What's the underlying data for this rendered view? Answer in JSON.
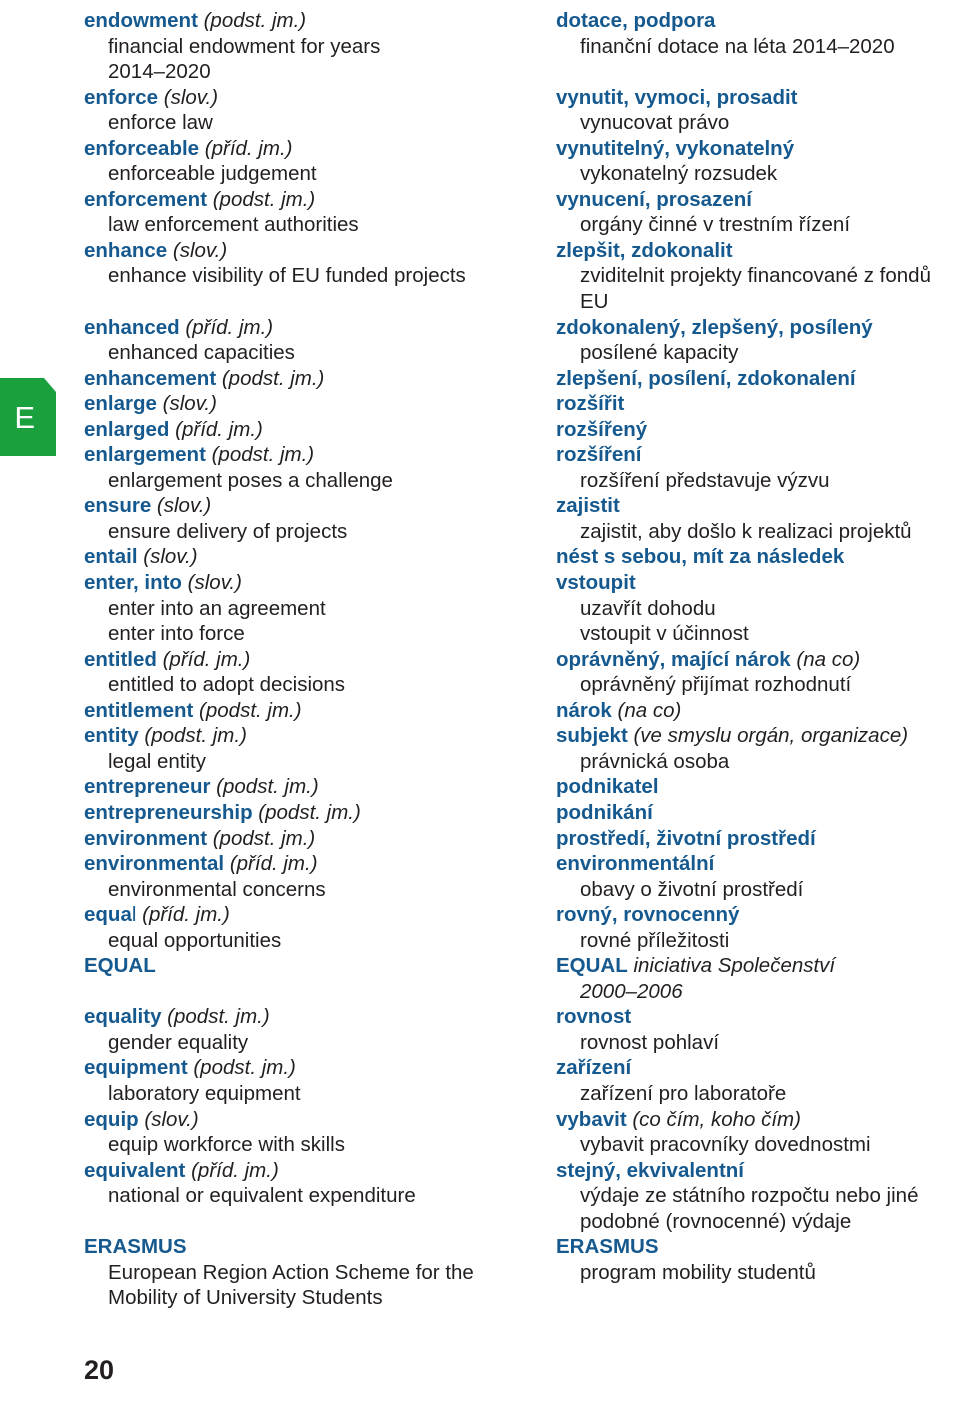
{
  "page": {
    "folio": "20",
    "letter_tab": "E",
    "colors": {
      "headword_blue": "#15598F",
      "tab_green": "#1AA03D",
      "body_text": "#231f20",
      "background": "#ffffff"
    }
  },
  "columns": {
    "english": [
      {
        "type": "head",
        "hw": "endowment",
        "pos": "(podst. jm.)"
      },
      {
        "type": "sub",
        "text": "financial endowment for years"
      },
      {
        "type": "cont",
        "text": "2014–2020"
      },
      {
        "type": "head",
        "hw": "enforce",
        "pos": "(slov.)"
      },
      {
        "type": "sub",
        "text": "enforce law"
      },
      {
        "type": "head",
        "hw": "enforceable",
        "pos": "(příd. jm.)"
      },
      {
        "type": "sub",
        "text": "enforceable judgement"
      },
      {
        "type": "head",
        "hw": "enforcement",
        "pos": "(podst. jm.)"
      },
      {
        "type": "sub",
        "text": "law enforcement authorities"
      },
      {
        "type": "head",
        "hw": "enhance",
        "pos": "(slov.)"
      },
      {
        "type": "sub",
        "text": "enhance visibility of EU funded projects"
      },
      {
        "type": "blank"
      },
      {
        "type": "head",
        "hw": "enhanced",
        "pos": "(příd. jm.)"
      },
      {
        "type": "sub",
        "text": "enhanced capacities"
      },
      {
        "type": "head",
        "hw": "enhancement",
        "pos": "(podst. jm.)"
      },
      {
        "type": "head",
        "hw": "enlarge",
        "pos": "(slov.)"
      },
      {
        "type": "head",
        "hw": "enlarged",
        "pos": "(příd. jm.)"
      },
      {
        "type": "head",
        "hw": "enlargement",
        "pos": "(podst. jm.)"
      },
      {
        "type": "sub",
        "text": "enlargement poses a challenge"
      },
      {
        "type": "head",
        "hw": "ensure",
        "pos": "(slov.)"
      },
      {
        "type": "sub",
        "text": "ensure delivery of projects"
      },
      {
        "type": "head",
        "hw": "entail",
        "pos": "(slov.)"
      },
      {
        "type": "head",
        "hw": "enter, into",
        "pos": "(slov.)"
      },
      {
        "type": "sub",
        "text": "enter into an agreement"
      },
      {
        "type": "sub",
        "text": "enter into force"
      },
      {
        "type": "head",
        "hw": "entitled",
        "pos": "(příd. jm.)"
      },
      {
        "type": "sub",
        "text": "entitled to adopt decisions"
      },
      {
        "type": "head",
        "hw": "entitlement",
        "pos": "(podst. jm.)"
      },
      {
        "type": "head",
        "hw": "entity",
        "pos": "(podst. jm.)"
      },
      {
        "type": "sub",
        "text": "legal entity"
      },
      {
        "type": "head",
        "hw": "entrepreneur",
        "pos": "(podst. jm.)"
      },
      {
        "type": "head",
        "hw": "entrepreneurship",
        "pos": "(podst. jm.)"
      },
      {
        "type": "head",
        "hw": "environment",
        "pos": "(podst. jm.)"
      },
      {
        "type": "head",
        "hw": "environmental",
        "pos": "(příd. jm.)"
      },
      {
        "type": "sub",
        "text": "environmental concerns"
      },
      {
        "type": "head",
        "hw": "equa",
        "hw_tail": "l",
        "pos": "(příd. jm.)"
      },
      {
        "type": "sub",
        "text": "equal opportunities"
      },
      {
        "type": "head",
        "hw": "EQUAL",
        "pos": ""
      },
      {
        "type": "blank"
      },
      {
        "type": "head",
        "hw": "equality",
        "pos": "(podst. jm.)"
      },
      {
        "type": "sub",
        "text": "gender equality"
      },
      {
        "type": "head",
        "hw": "equipment",
        "pos": "(podst. jm.)"
      },
      {
        "type": "sub",
        "text": "laboratory equipment"
      },
      {
        "type": "head",
        "hw": "equip",
        "pos": "(slov.)"
      },
      {
        "type": "sub",
        "text": "equip workforce with skills"
      },
      {
        "type": "head",
        "hw": "equivalent",
        "pos": "(příd. jm.)"
      },
      {
        "type": "sub",
        "text": "national or equivalent expenditure"
      },
      {
        "type": "blank"
      },
      {
        "type": "head",
        "hw": "ERASMUS",
        "pos": ""
      },
      {
        "type": "sub",
        "text": "European Region Action Scheme for the"
      },
      {
        "type": "cont",
        "text": "Mobility of University Students"
      }
    ],
    "czech": [
      {
        "type": "head",
        "hw": "dotace, podpora",
        "pos": ""
      },
      {
        "type": "sub",
        "text": "finanční dotace na léta 2014–2020"
      },
      {
        "type": "blank"
      },
      {
        "type": "head",
        "hw": "vynutit, vymoci, prosadit",
        "pos": ""
      },
      {
        "type": "sub",
        "text": "vynucovat právo"
      },
      {
        "type": "head",
        "hw": "vynutitelný, vykonatelný",
        "pos": ""
      },
      {
        "type": "sub",
        "text": "vykonatelný rozsudek"
      },
      {
        "type": "head",
        "hw": "vynucení, prosazení",
        "pos": ""
      },
      {
        "type": "sub",
        "text": "orgány činné v trestním řízení"
      },
      {
        "type": "head",
        "hw": "zlepšit, zdokonalit",
        "pos": ""
      },
      {
        "type": "sub",
        "text": "zviditelnit projekty financované z fondů"
      },
      {
        "type": "cont",
        "text": "EU"
      },
      {
        "type": "head",
        "hw": "zdokonalený, zlepšený, posílený",
        "pos": ""
      },
      {
        "type": "sub",
        "text": "posílené kapacity"
      },
      {
        "type": "head",
        "hw": "zlepšení, posílení, zdokonalení",
        "pos": ""
      },
      {
        "type": "head",
        "hw": "rozšířit",
        "pos": ""
      },
      {
        "type": "head",
        "hw": "rozšířený",
        "pos": ""
      },
      {
        "type": "head",
        "hw": "rozšíření",
        "pos": ""
      },
      {
        "type": "sub",
        "text": "rozšíření představuje výzvu"
      },
      {
        "type": "head",
        "hw": "zajistit",
        "pos": ""
      },
      {
        "type": "sub",
        "text": "zajistit, aby došlo k realizaci projektů"
      },
      {
        "type": "head",
        "hw": "nést s sebou, mít za následek",
        "pos": ""
      },
      {
        "type": "head",
        "hw": "vstoupit",
        "pos": ""
      },
      {
        "type": "sub",
        "text": "uzavřít dohodu"
      },
      {
        "type": "sub",
        "text": "vstoupit v účinnost"
      },
      {
        "type": "head",
        "hw": "oprávněný, mající nárok",
        "pos": "(na co)"
      },
      {
        "type": "sub",
        "text": "oprávněný přijímat rozhodnutí"
      },
      {
        "type": "head",
        "hw": "nárok",
        "pos": "(na co)"
      },
      {
        "type": "head",
        "hw": "subjekt",
        "pos": "(ve smyslu orgán, organizace)"
      },
      {
        "type": "sub",
        "text": "právnická osoba"
      },
      {
        "type": "head",
        "hw": "podnikatel",
        "pos": ""
      },
      {
        "type": "head",
        "hw": "podnikání",
        "pos": ""
      },
      {
        "type": "head",
        "hw": "prostředí, životní prostředí",
        "pos": ""
      },
      {
        "type": "head",
        "hw": "environmentální",
        "pos": ""
      },
      {
        "type": "sub",
        "text": "obavy o životní prostředí"
      },
      {
        "type": "head",
        "hw": "rovný, rovnocenný",
        "pos": ""
      },
      {
        "type": "sub",
        "text": "rovné příležitosti"
      },
      {
        "type": "head",
        "hw": "EQUAL",
        "pos": "iniciativa Společenství"
      },
      {
        "type": "cont",
        "italic": true,
        "text": "2000–2006"
      },
      {
        "type": "head",
        "hw": "rovnost",
        "pos": ""
      },
      {
        "type": "sub",
        "text": "rovnost pohlaví"
      },
      {
        "type": "head",
        "hw": "zařízení",
        "pos": ""
      },
      {
        "type": "sub",
        "text": "zařízení pro laboratoře"
      },
      {
        "type": "head",
        "hw": "vybavit",
        "pos": "(co čím, koho čím)"
      },
      {
        "type": "sub",
        "text": "vybavit pracovníky dovednostmi"
      },
      {
        "type": "head",
        "hw": "stejný, ekvivalentní",
        "pos": ""
      },
      {
        "type": "sub",
        "text": "výdaje ze státního rozpočtu nebo jiné"
      },
      {
        "type": "cont",
        "text": "podobné (rovnocenné) výdaje"
      },
      {
        "type": "head",
        "hw": "ERASMUS",
        "pos": ""
      },
      {
        "type": "sub",
        "text": "program mobility studentů"
      }
    ]
  }
}
